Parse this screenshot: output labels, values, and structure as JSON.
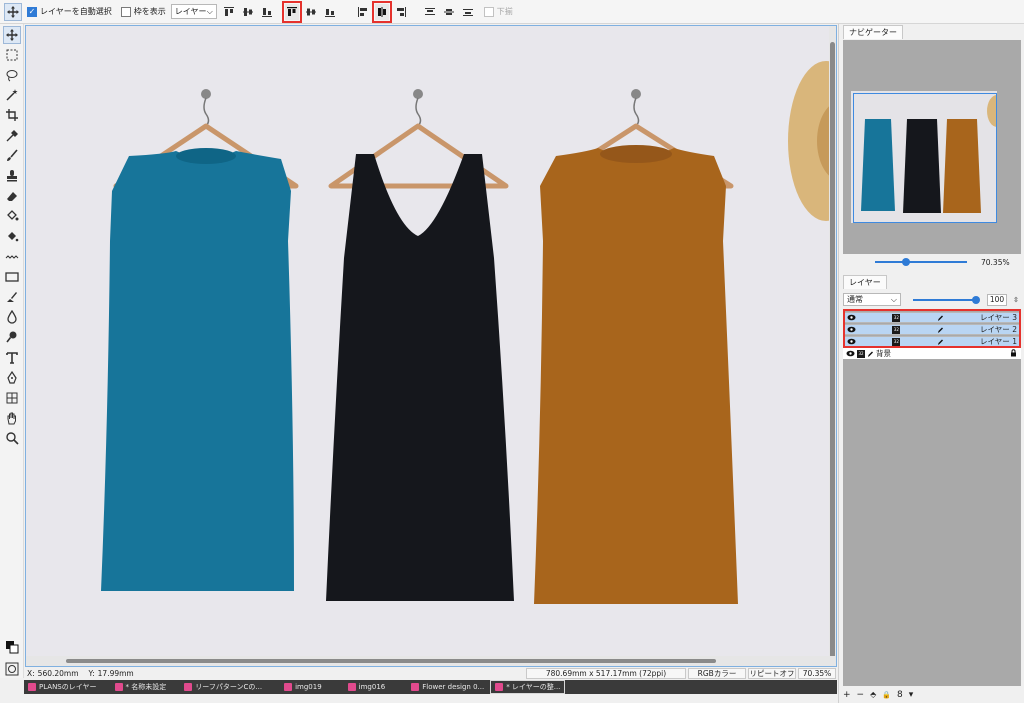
{
  "option_bar": {
    "auto_select_label": "レイヤーを自動選択",
    "auto_select_checked": true,
    "show_bounds_label": "枠を表示",
    "show_bounds_checked": false,
    "target_value": "レイヤー",
    "bottom_align_label": "下揃",
    "align_icons": [
      "align-top-icon",
      "align-vcenter-icon",
      "align-bottom-icon",
      "align-top-edge-icon",
      "align-middle-icon",
      "align-bottom-edge-icon",
      "align-left-icon",
      "align-hcenter-icon",
      "align-right-icon",
      "distribute-top-icon",
      "distribute-middle-icon",
      "distribute-bottom-icon"
    ],
    "highlight_color": "#e5322d"
  },
  "toolbox": {
    "tools": [
      "move-icon",
      "marquee-icon",
      "lasso-icon",
      "magic-wand-icon",
      "crop-icon",
      "eyedropper-icon",
      "brush-icon",
      "stamp-icon",
      "eraser-icon",
      "bucket-icon",
      "fill-tool-icon",
      "gradient-icon",
      "shape-icon",
      "smudge-icon",
      "blur-icon",
      "dodge-icon",
      "text-icon",
      "pen-icon",
      "grid-icon",
      "hand-icon",
      "zoom-icon"
    ]
  },
  "canvas": {
    "dresses": [
      {
        "name": "blue",
        "color": "#17759a"
      },
      {
        "name": "black",
        "color": "#15171c"
      },
      {
        "name": "brown",
        "color": "#a8651c"
      }
    ]
  },
  "status": {
    "x_label": "X:",
    "x_value": "560.20mm",
    "y_label": "Y:",
    "y_value": "17.99mm",
    "doc_size": "780.69mm x 517.17mm (72ppi)",
    "color_mode": "RGBカラー",
    "repeat": "リピートオフ",
    "zoom": "70.35%"
  },
  "doc_tabs": [
    {
      "label": "PLANSのレイヤー",
      "active": false
    },
    {
      "label": "* 名称未設定",
      "active": false
    },
    {
      "label": "リーフパターンCの...",
      "active": false
    },
    {
      "label": "img019",
      "active": false
    },
    {
      "label": "img016",
      "active": false
    },
    {
      "label": "Flower design 0...",
      "active": false
    },
    {
      "label": "* レイヤーの整...",
      "active": true
    }
  ],
  "navigator": {
    "tab_label": "ナビゲーター",
    "zoom": "70.35%",
    "zoom_fraction": 0.24
  },
  "layers": {
    "tab_label": "レイヤー",
    "blend_mode": "通常",
    "opacity": "100",
    "items": [
      {
        "name": "レイヤー 3",
        "selected": true,
        "locked": false,
        "thumb": "32"
      },
      {
        "name": "レイヤー 2",
        "selected": true,
        "locked": false,
        "thumb": "32"
      },
      {
        "name": "レイヤー 1",
        "selected": true,
        "locked": false,
        "thumb": "32"
      },
      {
        "name": "背景",
        "selected": false,
        "locked": true,
        "thumb": "32"
      }
    ],
    "footer": [
      "+",
      "−",
      "⬘",
      "🔒",
      "8",
      "▾"
    ]
  }
}
